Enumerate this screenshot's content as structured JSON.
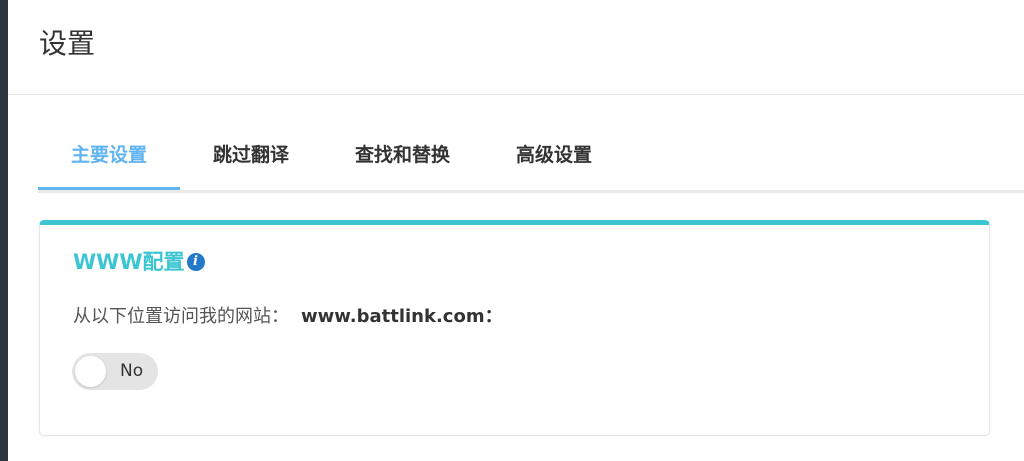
{
  "page": {
    "title": "设置"
  },
  "tabs": [
    {
      "label": "主要设置",
      "active": true
    },
    {
      "label": "跳过翻译",
      "active": false
    },
    {
      "label": "查找和替换",
      "active": false
    },
    {
      "label": "高级设置",
      "active": false
    }
  ],
  "www_card": {
    "title": "WWW配置",
    "info_icon": "info-icon",
    "access_prefix": "从以下位置访问我的网站：",
    "domain": "www.battlink.com：",
    "toggle": {
      "label": "No",
      "on": false
    }
  },
  "colors": {
    "accent_tab": "#60b4f0",
    "card_accent": "#3cc6d1",
    "info_icon": "#2378c8"
  }
}
